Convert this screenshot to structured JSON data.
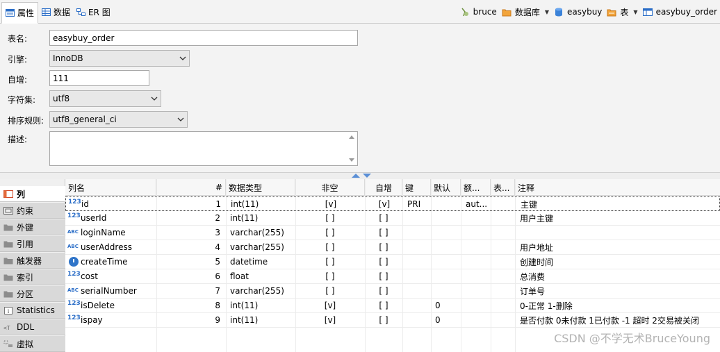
{
  "tabs": [
    {
      "label": "属性",
      "icon": "properties-icon",
      "active": true
    },
    {
      "label": "数据",
      "icon": "data-grid-icon",
      "active": false
    },
    {
      "label": "ER 图",
      "icon": "er-diagram-icon",
      "active": false
    }
  ],
  "crumbs": {
    "connection": "bruce",
    "db_kind": "数据库",
    "database": "easybuy",
    "table_kind": "表",
    "table": "easybuy_order"
  },
  "form": {
    "table_name_label": "表名:",
    "table_name": "easybuy_order",
    "engine_label": "引擎:",
    "engine": "InnoDB",
    "auto_inc_label": "自增:",
    "auto_inc": "111",
    "charset_label": "字符集:",
    "charset": "utf8",
    "collation_label": "排序规则:",
    "collation": "utf8_general_ci",
    "desc_label": "描述:",
    "desc": ""
  },
  "side_tabs": [
    {
      "label": "列",
      "icon": "columns-icon",
      "active": true
    },
    {
      "label": "约束",
      "icon": "constraint-icon",
      "active": false
    },
    {
      "label": "外键",
      "icon": "folder-icon",
      "active": false
    },
    {
      "label": "引用",
      "icon": "folder-icon",
      "active": false
    },
    {
      "label": "触发器",
      "icon": "folder-icon",
      "active": false
    },
    {
      "label": "索引",
      "icon": "folder-icon",
      "active": false
    },
    {
      "label": "分区",
      "icon": "folder-icon",
      "active": false
    },
    {
      "label": "Statistics",
      "icon": "info-icon",
      "active": false
    },
    {
      "label": "DDL",
      "icon": "ddl-icon",
      "active": false
    },
    {
      "label": "虚拟",
      "icon": "virtual-icon",
      "active": false
    }
  ],
  "grid": {
    "headers": {
      "name": "列名",
      "num": "#",
      "type": "数据类型",
      "notnull": "非空",
      "autoinc": "自增",
      "key": "键",
      "default": "默认",
      "extra": "额...",
      "table": "表...",
      "comment": "注释"
    },
    "rows": [
      {
        "icon": "123",
        "name": "id",
        "num": "1",
        "type": "int(11)",
        "notnull": "[v]",
        "autoinc": "[v]",
        "key": "PRI",
        "default": "",
        "extra": "aut...",
        "comment": "主键"
      },
      {
        "icon": "123",
        "name": "userId",
        "num": "2",
        "type": "int(11)",
        "notnull": "[ ]",
        "autoinc": "[ ]",
        "key": "",
        "default": "",
        "extra": "",
        "comment": "用户主键"
      },
      {
        "icon": "ABC",
        "name": "loginName",
        "num": "3",
        "type": "varchar(255)",
        "notnull": "[ ]",
        "autoinc": "[ ]",
        "key": "",
        "default": "",
        "extra": "",
        "comment": ""
      },
      {
        "icon": "ABC",
        "name": "userAddress",
        "num": "4",
        "type": "varchar(255)",
        "notnull": "[ ]",
        "autoinc": "[ ]",
        "key": "",
        "default": "",
        "extra": "",
        "comment": "用户地址"
      },
      {
        "icon": "clock",
        "name": "createTime",
        "num": "5",
        "type": "datetime",
        "notnull": "[ ]",
        "autoinc": "[ ]",
        "key": "",
        "default": "",
        "extra": "",
        "comment": "创建时间"
      },
      {
        "icon": "123",
        "name": "cost",
        "num": "6",
        "type": "float",
        "notnull": "[ ]",
        "autoinc": "[ ]",
        "key": "",
        "default": "",
        "extra": "",
        "comment": "总消费"
      },
      {
        "icon": "ABC",
        "name": "serialNumber",
        "num": "7",
        "type": "varchar(255)",
        "notnull": "[ ]",
        "autoinc": "[ ]",
        "key": "",
        "default": "",
        "extra": "",
        "comment": "订单号"
      },
      {
        "icon": "123",
        "name": "isDelete",
        "num": "8",
        "type": "int(11)",
        "notnull": "[v]",
        "autoinc": "[ ]",
        "key": "",
        "default": "0",
        "extra": "",
        "comment": "0-正常 1-删除"
      },
      {
        "icon": "123",
        "name": "ispay",
        "num": "9",
        "type": "int(11)",
        "notnull": "[v]",
        "autoinc": "[ ]",
        "key": "",
        "default": "0",
        "extra": "",
        "comment": "是否付款 0未付款 1已付款 -1 超时 2交易被关闭"
      }
    ]
  },
  "watermark": "CSDN @不学无术BruceYoung",
  "colors": {
    "accent": "#2a6dc7",
    "panel": "#f3f3f3"
  }
}
